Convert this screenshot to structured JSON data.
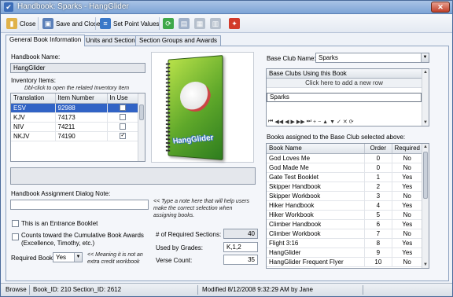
{
  "window": {
    "title": "Handbook: Sparks - HangGlider",
    "close": "✕"
  },
  "toolbar": {
    "close": "Close",
    "save_close": "Save and Close",
    "set_point_values": "Set Point Values"
  },
  "tabs": [
    "General Book Information",
    "Units and Sections",
    "Section Groups and Awards"
  ],
  "handbook": {
    "name_label": "Handbook Name:",
    "name_value": "HangGlider",
    "inventory_label": "Inventory Items:",
    "inventory_hint": "Dbl-click to open the related Inventory Item",
    "inventory_columns": [
      "Translation",
      "Item Number",
      "In Use"
    ],
    "inventory_rows": [
      {
        "translation": "ESV",
        "item": "92988",
        "in_use": false
      },
      {
        "translation": "KJV",
        "item": "74173",
        "in_use": false
      },
      {
        "translation": "NIV",
        "item": "74211",
        "in_use": false
      },
      {
        "translation": "NKJV",
        "item": "74190",
        "in_use": true
      }
    ]
  },
  "assignment": {
    "note_label": "Handbook Assignment Dialog Note:",
    "note_value": "",
    "note_hint": "<< Type a note here that will help users make the correct selection when assigning books.",
    "entrance_label": "This is an Entrance Booklet",
    "cumulative_label": "Counts toward the Cumulative Book Awards (Excellence, Timothy, etc.)",
    "required_label": "Required Book:",
    "required_value": "Yes",
    "required_hint": "<< Meaning it is not an extra credit workbook"
  },
  "stats": {
    "req_sections_label": "# of Required Sections:",
    "req_sections_value": "40",
    "grades_label": "Used by Grades:",
    "grades_value": "K,1,2",
    "verse_label": "Verse Count:",
    "verse_value": "35"
  },
  "base_club": {
    "label": "Base Club Name:",
    "value": "Sparks",
    "using_header": "Base Clubs Using this Book",
    "add_row": "Click here to add a new row",
    "using_rows": [
      "Sparks"
    ]
  },
  "books": {
    "label": "Books assigned to the Base Club selected above:",
    "columns": [
      "Book Name",
      "Order",
      "Required"
    ],
    "rows": [
      {
        "name": "God Loves Me",
        "order": "0",
        "req": "No"
      },
      {
        "name": "God Made Me",
        "order": "0",
        "req": "No"
      },
      {
        "name": "Gate Test Booklet",
        "order": "1",
        "req": "Yes"
      },
      {
        "name": "Skipper Handbook",
        "order": "2",
        "req": "Yes"
      },
      {
        "name": "Skipper Workbook",
        "order": "3",
        "req": "No"
      },
      {
        "name": "Hiker Handbook",
        "order": "4",
        "req": "Yes"
      },
      {
        "name": "Hiker Workbook",
        "order": "5",
        "req": "No"
      },
      {
        "name": "Climber Handbook",
        "order": "6",
        "req": "Yes"
      },
      {
        "name": "Climber Workbook",
        "order": "7",
        "req": "No"
      },
      {
        "name": "Flight 3:16",
        "order": "8",
        "req": "Yes"
      },
      {
        "name": "HangGlider",
        "order": "9",
        "req": "Yes"
      },
      {
        "name": "HangGlider Frequent Flyer",
        "order": "10",
        "req": "No"
      }
    ]
  },
  "book_cover_title": "HangGlider",
  "status": {
    "mode": "Browse",
    "ids": "Book_ID: 210  Section_ID: 2612",
    "modified": "Modified 8/12/2008 9:32:29 AM by Jane"
  }
}
